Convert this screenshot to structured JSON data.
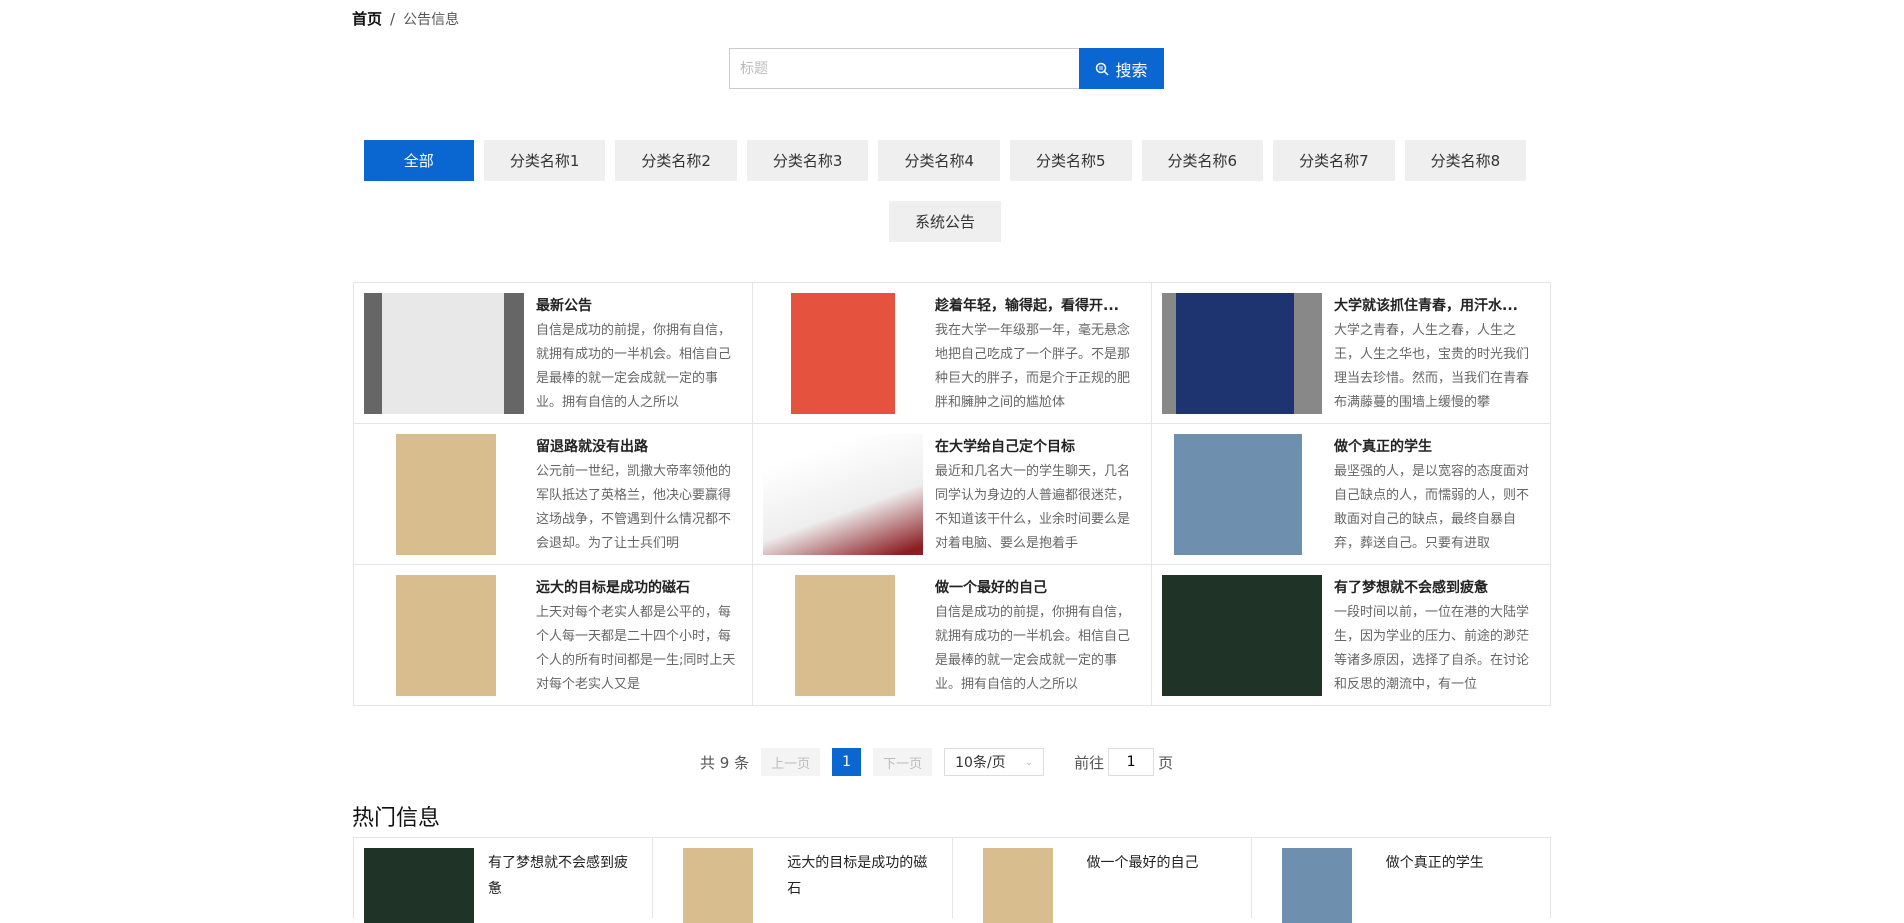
{
  "breadcrumb": {
    "home": "首页",
    "sep": "/",
    "current": "公告信息"
  },
  "search": {
    "placeholder": "标题",
    "button": "搜索"
  },
  "categories": [
    "全部",
    "分类名称1",
    "分类名称2",
    "分类名称3",
    "分类名称4",
    "分类名称5",
    "分类名称6",
    "分类名称7",
    "分类名称8",
    "系统公告"
  ],
  "items": [
    {
      "title": "最新公告",
      "desc": "自信是成功的前提，你拥有自信，就拥有成功的一半机会。相信自己是最棒的就一定会成就一定的事业。拥有自信的人之所以"
    },
    {
      "title": "趁着年轻，输得起，看得开...",
      "desc": "我在大学一年级那一年，毫无悬念地把自己吃成了一个胖子。不是那种巨大的胖子，而是介于正规的肥胖和臃肿之间的尴尬体"
    },
    {
      "title": "大学就该抓住青春，用汗水...",
      "desc": "大学之青春，人生之春，人生之王，人生之华也，宝贵的时光我们理当去珍惜。然而，当我们在青春布满藤蔓的围墙上缓慢的攀"
    },
    {
      "title": "留退路就没有出路",
      "desc": "公元前一世纪，凯撒大帝率领他的军队抵达了英格兰，他决心要赢得这场战争，不管遇到什么情况都不会退却。为了让士兵们明"
    },
    {
      "title": "在大学给自己定个目标",
      "desc": "最近和几名大一的学生聊天，几名同学认为身边的人普遍都很迷茫，不知道该干什么，业余时间要么是对着电脑、要么是抱着手"
    },
    {
      "title": "做个真正的学生",
      "desc": "最坚强的人，是以宽容的态度面对自己缺点的人，而懦弱的人，则不敢面对自己的缺点，最终自暴自弃，葬送自己。只要有进取"
    },
    {
      "title": "远大的目标是成功的磁石",
      "desc": "上天对每个老实人都是公平的，每个人每一天都是二十四个小时，每个人的所有时间都是一生;同时上天对每个老实人又是"
    },
    {
      "title": "做一个最好的自己",
      "desc": "自信是成功的前提，你拥有自信，就拥有成功的一半机会。相信自己是最棒的就一定会成就一定的事业。拥有自信的人之所以"
    },
    {
      "title": "有了梦想就不会感到疲惫",
      "desc": "一段时间以前，一位在港的大陆学生，因为学业的压力、前途的渺茫等诸多原因，选择了自杀。在讨论和反思的潮流中，有一位"
    }
  ],
  "pagination": {
    "total": "共 9 条",
    "prev": "上一页",
    "page": "1",
    "next": "下一页",
    "size": "10条/页",
    "goto": "前往",
    "goto_value": "1",
    "page_unit": "页"
  },
  "hot": {
    "heading": "热门信息",
    "items": [
      "有了梦想就不会感到疲惫",
      "远大的目标是成功的磁石",
      "做一个最好的自己",
      "做个真正的学生"
    ]
  },
  "colors": {
    "accent": "#0a66d0"
  }
}
